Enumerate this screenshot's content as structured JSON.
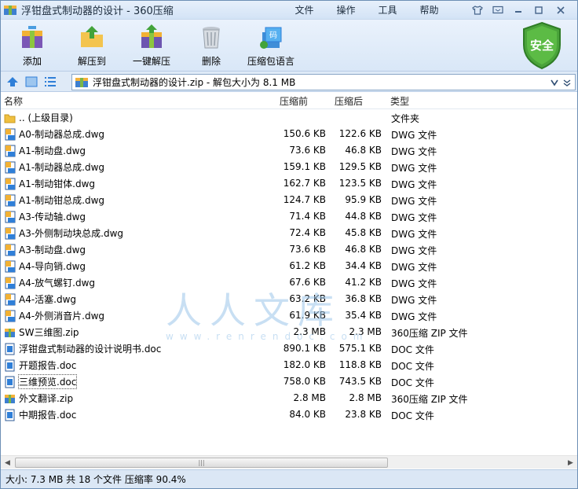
{
  "window": {
    "title": "浮钳盘式制动器的设计 - 360压缩"
  },
  "menu": [
    "文件",
    "操作",
    "工具",
    "帮助"
  ],
  "toolbar": {
    "add": "添加",
    "extract_to": "解压到",
    "one_click_extract": "一键解压",
    "delete": "删除",
    "code": "压缩包语言",
    "security": "安全"
  },
  "address": {
    "path": "浮钳盘式制动器的设计.zip - 解包大小为 8.1 MB"
  },
  "columns": {
    "name": "名称",
    "before": "压缩前",
    "after": "压缩后",
    "type": "类型"
  },
  "files": [
    {
      "name": ".. (上级目录)",
      "before": "",
      "after": "",
      "type": "文件夹",
      "icon": "folder-icon"
    },
    {
      "name": "A0-制动器总成.dwg",
      "before": "150.6 KB",
      "after": "122.6 KB",
      "type": "DWG 文件",
      "icon": "dwg-file-icon"
    },
    {
      "name": "A1-制动盘.dwg",
      "before": "73.6 KB",
      "after": "46.8 KB",
      "type": "DWG 文件",
      "icon": "dwg-file-icon"
    },
    {
      "name": "A1-制动器总成.dwg",
      "before": "159.1 KB",
      "after": "129.5 KB",
      "type": "DWG 文件",
      "icon": "dwg-file-icon"
    },
    {
      "name": "A1-制动钳体.dwg",
      "before": "162.7 KB",
      "after": "123.5 KB",
      "type": "DWG 文件",
      "icon": "dwg-file-icon"
    },
    {
      "name": "A1-制动钳总成.dwg",
      "before": "124.7 KB",
      "after": "95.9 KB",
      "type": "DWG 文件",
      "icon": "dwg-file-icon"
    },
    {
      "name": "A3-传动轴.dwg",
      "before": "71.4 KB",
      "after": "44.8 KB",
      "type": "DWG 文件",
      "icon": "dwg-file-icon"
    },
    {
      "name": "A3-外侧制动块总成.dwg",
      "before": "72.4 KB",
      "after": "45.8 KB",
      "type": "DWG 文件",
      "icon": "dwg-file-icon"
    },
    {
      "name": "A3-制动盘.dwg",
      "before": "73.6 KB",
      "after": "46.8 KB",
      "type": "DWG 文件",
      "icon": "dwg-file-icon"
    },
    {
      "name": "A4-导向销.dwg",
      "before": "61.2 KB",
      "after": "34.4 KB",
      "type": "DWG 文件",
      "icon": "dwg-file-icon"
    },
    {
      "name": "A4-放气螺钉.dwg",
      "before": "67.6 KB",
      "after": "41.2 KB",
      "type": "DWG 文件",
      "icon": "dwg-file-icon"
    },
    {
      "name": "A4-活塞.dwg",
      "before": "63.2 KB",
      "after": "36.8 KB",
      "type": "DWG 文件",
      "icon": "dwg-file-icon"
    },
    {
      "name": "A4-外侧消音片.dwg",
      "before": "61.9 KB",
      "after": "35.4 KB",
      "type": "DWG 文件",
      "icon": "dwg-file-icon"
    },
    {
      "name": "SW三维图.zip",
      "before": "2.3 MB",
      "after": "2.3 MB",
      "type": "360压缩 ZIP 文件",
      "icon": "zip-file-icon"
    },
    {
      "name": "浮钳盘式制动器的设计说明书.doc",
      "before": "890.1 KB",
      "after": "575.1 KB",
      "type": "DOC 文件",
      "icon": "doc-file-icon"
    },
    {
      "name": "开题报告.doc",
      "before": "182.0 KB",
      "after": "118.8 KB",
      "type": "DOC 文件",
      "icon": "doc-file-icon"
    },
    {
      "name": "三维预览.doc",
      "before": "758.0 KB",
      "after": "743.5 KB",
      "type": "DOC 文件",
      "icon": "doc-file-icon",
      "selected": true
    },
    {
      "name": "外文翻译.zip",
      "before": "2.8 MB",
      "after": "2.8 MB",
      "type": "360压缩 ZIP 文件",
      "icon": "zip-file-icon"
    },
    {
      "name": "中期报告.doc",
      "before": "84.0 KB",
      "after": "23.8 KB",
      "type": "DOC 文件",
      "icon": "doc-file-icon"
    }
  ],
  "watermark": {
    "big": "人人文库",
    "small": "www.renrendoc.com"
  },
  "status": {
    "text": "大小: 7.3 MB 共 18 个文件 压缩率 90.4%"
  },
  "colors": {
    "accent": "#2f7fd8",
    "shield": "#4aa33a",
    "selected_outline": "#555555"
  }
}
